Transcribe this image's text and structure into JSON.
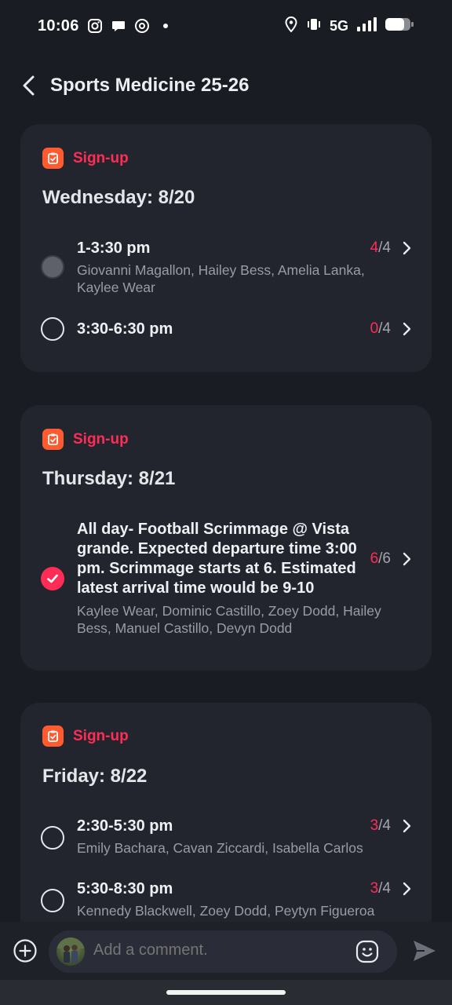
{
  "status_bar": {
    "time": "10:06",
    "network": "5G",
    "icons": [
      "instagram-icon",
      "chat-bubble-icon",
      "threads-icon",
      "dot-icon",
      "location-icon",
      "vibrate-icon",
      "signal-icon",
      "battery-icon"
    ]
  },
  "header": {
    "title": "Sports Medicine 25-26"
  },
  "cards": [
    {
      "tag": "Sign-up",
      "day": "Wednesday: 8/20",
      "slots": [
        {
          "title": "1-3:30 pm",
          "filled": "4",
          "total": "/4",
          "names": "Giovanni Magallon, Hailey Bess, Amelia Lanka, Kaylee Wear",
          "state": "disabled"
        },
        {
          "title": "3:30-6:30 pm",
          "filled": "0",
          "total": "/4",
          "names": "",
          "state": "empty"
        }
      ]
    },
    {
      "tag": "Sign-up",
      "day": "Thursday: 8/21",
      "slots": [
        {
          "title": "All day- Football Scrimmage @ Vista grande. Expected departure time 3:00 pm. Scrimmage starts at 6. Estimated latest arrival time would be 9-10",
          "filled": "6",
          "total": "/6",
          "names": "Kaylee Wear, Dominic Castillo, Zoey Dodd, Hailey Bess, Manuel Castillo, Devyn Dodd",
          "state": "checked"
        }
      ]
    },
    {
      "tag": "Sign-up",
      "day": "Friday: 8/22",
      "slots": [
        {
          "title": "2:30-5:30 pm",
          "filled": "3",
          "total": "/4",
          "names": "Emily Bachara, Cavan Ziccardi, Isabella Carlos",
          "state": "empty"
        },
        {
          "title": "5:30-8:30 pm",
          "filled": "3",
          "total": "/4",
          "names": "Kennedy Blackwell, Zoey Dodd, Peytyn Figueroa",
          "state": "empty"
        }
      ]
    }
  ],
  "composer": {
    "placeholder": "Add a comment."
  },
  "colors": {
    "accent": "#ff2d55",
    "tag_icon": "#ff5a30",
    "background": "#1a1c24",
    "card": "#22252e"
  }
}
